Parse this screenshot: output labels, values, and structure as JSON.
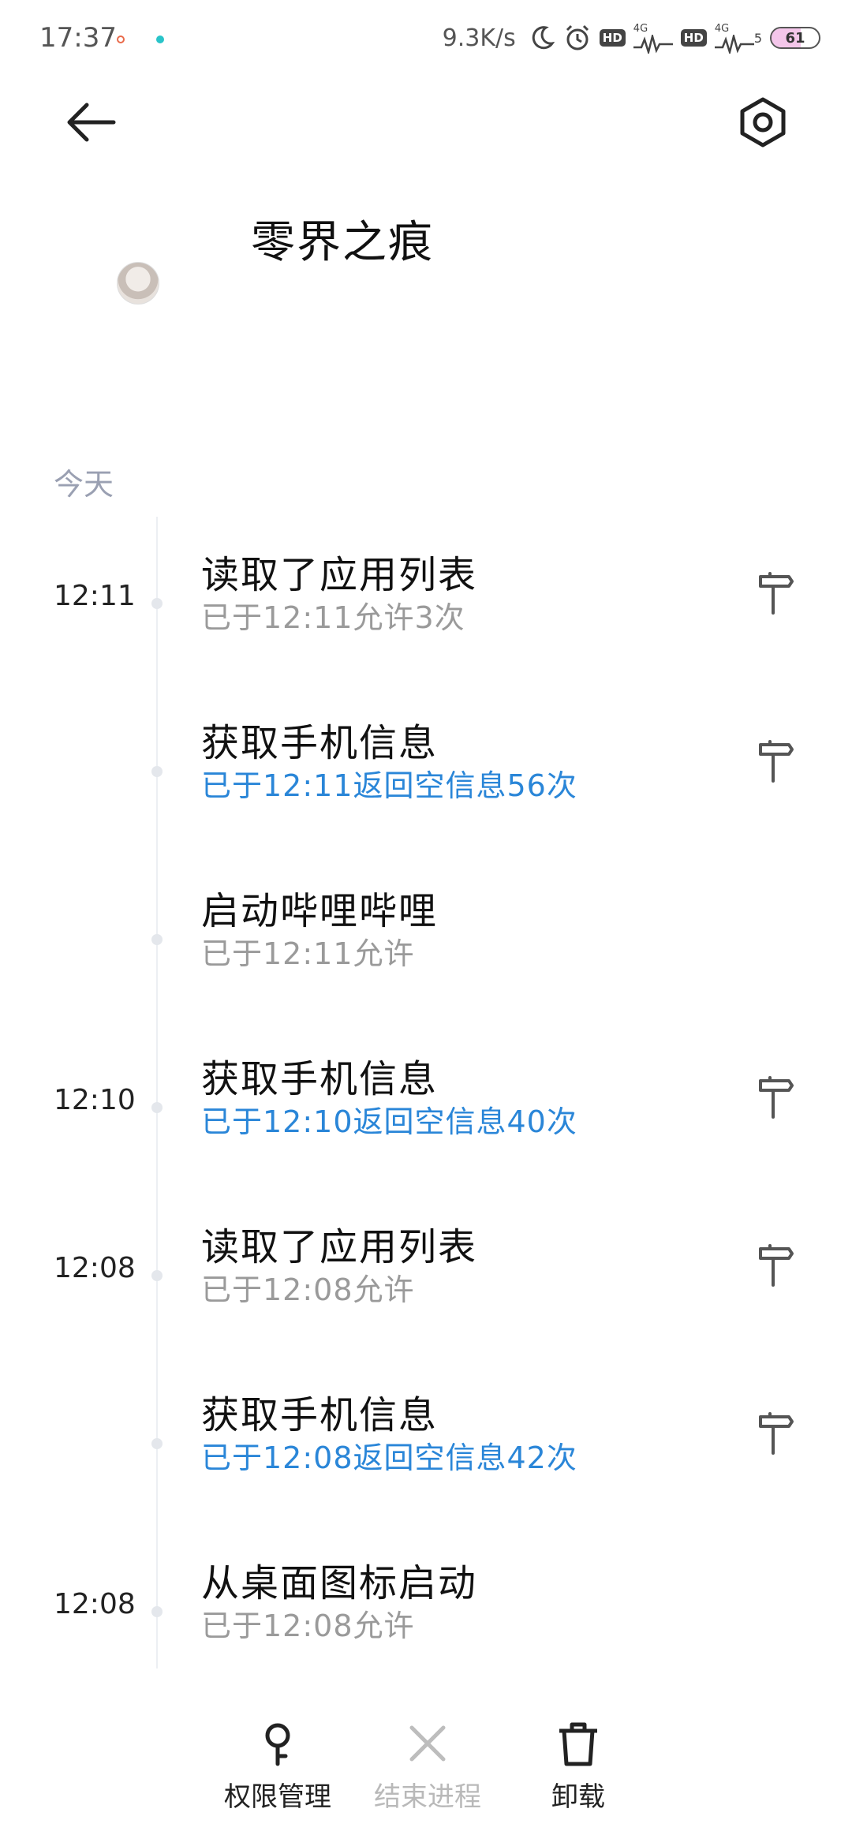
{
  "status_bar": {
    "time": "17:37",
    "network_speed": "9.3K/s",
    "signal1_label": "4G",
    "signal2_label": "4G",
    "signal2_level": "5",
    "hd_label": "HD",
    "battery_level": "61",
    "battery_fraction": 0.61,
    "icons": [
      "moon-icon",
      "alarm-icon",
      "hd-icon",
      "signal-icon",
      "battery-icon"
    ]
  },
  "header": {
    "back_icon": "arrow-left-icon",
    "settings_icon": "hexagon-settings-icon"
  },
  "app": {
    "name": "零界之痕"
  },
  "section": {
    "date_label": "今天"
  },
  "entries": [
    {
      "time": "12:11",
      "title": "读取了应用列表",
      "subtitle": "已于12:11允许3次",
      "highlight": false,
      "has_pin": true
    },
    {
      "time": "",
      "title": "获取手机信息",
      "subtitle": "已于12:11返回空信息56次",
      "highlight": true,
      "has_pin": true
    },
    {
      "time": "",
      "title": "启动哔哩哔哩",
      "subtitle": "已于12:11允许",
      "highlight": false,
      "has_pin": false
    },
    {
      "time": "12:10",
      "title": "获取手机信息",
      "subtitle": "已于12:10返回空信息40次",
      "highlight": true,
      "has_pin": true
    },
    {
      "time": "12:08",
      "title": "读取了应用列表",
      "subtitle": "已于12:08允许",
      "highlight": false,
      "has_pin": true
    },
    {
      "time": "",
      "title": "获取手机信息",
      "subtitle": "已于12:08返回空信息42次",
      "highlight": true,
      "has_pin": true
    },
    {
      "time": "12:08",
      "title": "从桌面图标启动",
      "subtitle": "已于12:08允许",
      "highlight": false,
      "has_pin": false
    }
  ],
  "bottom_actions": [
    {
      "label": "权限管理",
      "icon": "key-icon",
      "enabled": true
    },
    {
      "label": "结束进程",
      "icon": "close-icon",
      "enabled": false
    },
    {
      "label": "卸载",
      "icon": "trash-icon",
      "enabled": true
    }
  ],
  "colors": {
    "highlight_blue": "#2a86d8",
    "muted_gray": "#9a9a9a",
    "date_label": "#9aa0b2",
    "disabled": "#b9b9b9"
  }
}
